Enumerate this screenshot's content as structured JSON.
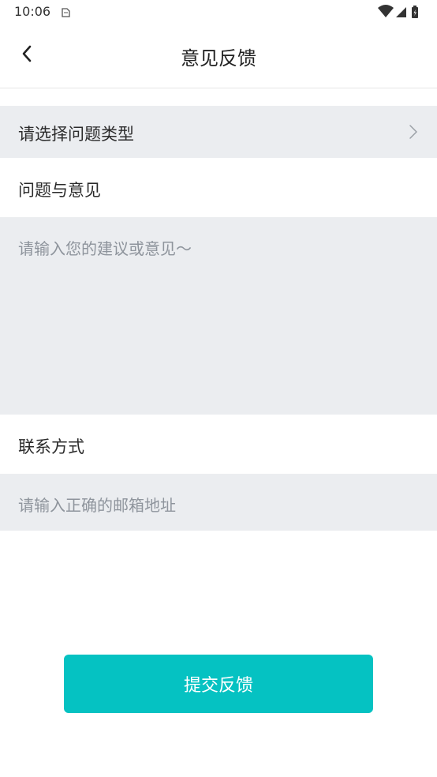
{
  "status_bar": {
    "time": "10:06",
    "icons": [
      "sim-card-icon",
      "wifi-icon",
      "signal-icon",
      "battery-icon"
    ]
  },
  "nav": {
    "title": "意见反馈",
    "back_icon": "chevron-left-icon"
  },
  "form": {
    "type_select": {
      "label": "请选择问题类型",
      "icon": "chevron-right-icon"
    },
    "feedback": {
      "section_label": "问题与意见",
      "value": "",
      "placeholder": "请输入您的建议或意见～"
    },
    "contact": {
      "section_label": "联系方式",
      "value": "",
      "placeholder": "请输入正确的邮箱地址"
    },
    "submit_label": "提交反馈"
  },
  "colors": {
    "accent": "#05c2c2",
    "field_background": "#ebedf0",
    "placeholder_text": "#8e949c",
    "primary_text": "#2b2b2b"
  }
}
